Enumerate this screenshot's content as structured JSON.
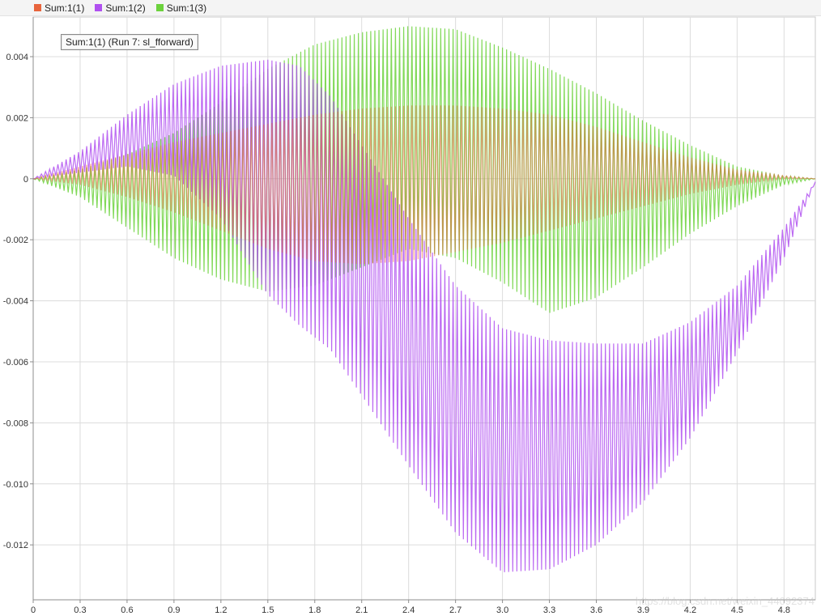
{
  "legend": [
    {
      "label": "Sum:1(1)",
      "color": "#e8643c"
    },
    {
      "label": "Sum:1(2)",
      "color": "#b050f0"
    },
    {
      "label": "Sum:1(3)",
      "color": "#6cd23c"
    }
  ],
  "cursor_label": "Sum:1(1) (Run 7: sl_fforward)",
  "watermark": "https://blog.csdn.net/weixin_44092374",
  "chart_data": {
    "type": "line",
    "title": "",
    "xlabel": "",
    "ylabel": "",
    "xlim": [
      0,
      5.0
    ],
    "ylim": [
      -0.0138,
      0.0053
    ],
    "grid": true,
    "legend_position": "top",
    "x_ticks": [
      0,
      0.3,
      0.6,
      0.9,
      1.2,
      1.5,
      1.8,
      2.1,
      2.4,
      2.7,
      3.0,
      3.3,
      3.6,
      3.9,
      4.2,
      4.5,
      4.8
    ],
    "x_tick_labels": [
      "0",
      "0.3",
      "0.6",
      "0.9",
      "1.2",
      "1.5",
      "1.8",
      "2.1",
      "2.4",
      "2.7",
      "3.0",
      "3.3",
      "3.6",
      "3.9",
      "4.2",
      "4.5",
      "4.8"
    ],
    "y_ticks": [
      0.004,
      0.002,
      0,
      -0.002,
      -0.004,
      -0.006,
      -0.008,
      -0.01,
      -0.012
    ],
    "y_tick_labels": [
      "0.004",
      "0.002",
      "0",
      "-0.002",
      "-0.004",
      "-0.006",
      "-0.008",
      "-0.010",
      "-0.012"
    ],
    "oscillation_periods": 190,
    "series": [
      {
        "name": "Sum:1(1)",
        "color": "#e8643c",
        "upper_envelope": {
          "x": [
            0,
            0.3,
            0.6,
            0.9,
            1.2,
            1.5,
            1.8,
            2.1,
            2.4,
            2.7,
            3.0,
            3.3,
            3.6,
            3.9,
            4.2,
            4.5,
            4.8,
            5.0
          ],
          "y": [
            0,
            0.0004,
            0.0008,
            0.0012,
            0.0015,
            0.0018,
            0.0021,
            0.0023,
            0.0024,
            0.0024,
            0.0023,
            0.0021,
            0.0017,
            0.0012,
            0.0007,
            0.0003,
            0.0001,
            0
          ]
        },
        "lower_envelope": {
          "x": [
            0,
            0.3,
            0.6,
            0.9,
            1.2,
            1.5,
            1.8,
            2.1,
            2.4,
            2.7,
            3.0,
            3.3,
            3.6,
            3.9,
            4.2,
            4.5,
            4.8,
            5.0
          ],
          "y": [
            0,
            -0.0002,
            -0.0006,
            -0.0011,
            -0.0017,
            -0.0023,
            -0.0027,
            -0.0028,
            -0.0027,
            -0.0024,
            -0.0021,
            -0.0017,
            -0.0013,
            -0.0009,
            -0.0005,
            -0.0002,
            0,
            0
          ]
        }
      },
      {
        "name": "Sum:1(2)",
        "color": "#b050f0",
        "upper_envelope": {
          "x": [
            0,
            0.3,
            0.6,
            0.9,
            1.2,
            1.5,
            1.7,
            1.9,
            2.1,
            2.4,
            2.7,
            3.0,
            3.3,
            3.6,
            3.9,
            4.2,
            4.5,
            4.8,
            5.0
          ],
          "y": [
            0,
            0.0009,
            0.0021,
            0.0031,
            0.0037,
            0.0039,
            0.0037,
            0.0027,
            0.0011,
            -0.0013,
            -0.0035,
            -0.0049,
            -0.0053,
            -0.0054,
            -0.0054,
            -0.0047,
            -0.0035,
            -0.0016,
            -0.0001
          ]
        },
        "lower_envelope": {
          "x": [
            0,
            0.3,
            0.6,
            0.9,
            1.2,
            1.5,
            1.7,
            1.9,
            2.1,
            2.4,
            2.7,
            3.0,
            3.3,
            3.6,
            3.9,
            4.2,
            4.5,
            4.8,
            5.0
          ],
          "y": [
            0,
            0.0002,
            0.0004,
            0.0001,
            -0.0013,
            -0.0038,
            -0.0048,
            -0.0056,
            -0.0071,
            -0.0094,
            -0.0116,
            -0.0129,
            -0.0128,
            -0.012,
            -0.0106,
            -0.0085,
            -0.0057,
            -0.0026,
            -0.0001
          ]
        }
      },
      {
        "name": "Sum:1(3)",
        "color": "#6cd23c",
        "upper_envelope": {
          "x": [
            0,
            0.3,
            0.6,
            0.9,
            1.2,
            1.5,
            1.8,
            2.1,
            2.4,
            2.7,
            3.0,
            3.3,
            3.6,
            3.9,
            4.2,
            4.5,
            4.8,
            5.0
          ],
          "y": [
            0,
            0.0003,
            0.0008,
            0.0015,
            0.0025,
            0.0036,
            0.0044,
            0.0048,
            0.005,
            0.0049,
            0.0043,
            0.0036,
            0.0028,
            0.0019,
            0.0011,
            0.0004,
            0.0001,
            0
          ]
        },
        "lower_envelope": {
          "x": [
            0,
            0.3,
            0.6,
            0.9,
            1.2,
            1.5,
            1.8,
            2.1,
            2.4,
            2.7,
            3.0,
            3.3,
            3.6,
            3.9,
            4.2,
            4.5,
            4.8,
            5.0
          ],
          "y": [
            0,
            -0.0006,
            -0.0016,
            -0.0026,
            -0.0033,
            -0.0037,
            -0.0035,
            -0.0029,
            -0.0023,
            -0.0026,
            -0.0034,
            -0.0044,
            -0.0039,
            -0.0029,
            -0.0018,
            -0.0009,
            -0.0002,
            0
          ]
        }
      }
    ]
  }
}
